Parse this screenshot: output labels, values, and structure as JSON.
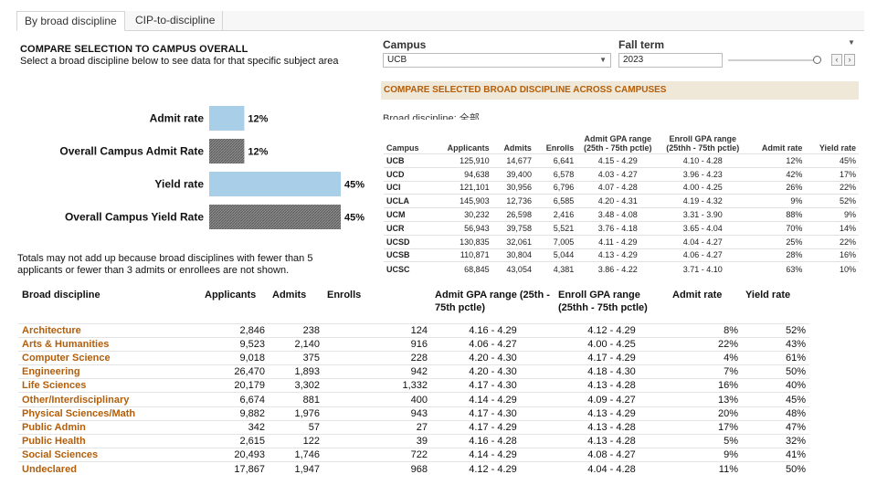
{
  "tabs": [
    {
      "label": "By broad discipline",
      "active": true
    },
    {
      "label": "CIP-to-discipline",
      "active": false
    }
  ],
  "left_panel": {
    "heading": "COMPARE SELECTION TO CAMPUS OVERALL",
    "subheading": "Select a broad discipline below to see data for that specific subject area",
    "note": "Totals may not add up because broad disciplines with fewer than 5 applicants or fewer than 3 admits or enrollees are not shown."
  },
  "chart_data": {
    "type": "bar",
    "orientation": "horizontal",
    "categories": [
      "Admit rate",
      "Overall Campus Admit Rate",
      "Yield rate",
      "Overall Campus Yield Rate"
    ],
    "values": [
      12,
      12,
      45,
      45
    ],
    "value_labels": [
      "12%",
      "12%",
      "45%",
      "45%"
    ],
    "unit": "%",
    "xlim": [
      0,
      45
    ],
    "bar_styles": [
      "solid-light-blue",
      "hatched-gray",
      "solid-light-blue",
      "hatched-gray"
    ],
    "colors": {
      "solid": "#a9cfe8",
      "hatched": "#7a7a7a"
    },
    "grid": false
  },
  "filters": {
    "campus_label": "Campus",
    "campus_value": "UCB",
    "fall_term_label": "Fall term",
    "fall_term_value": "2023",
    "prev_icon": "chevron-left-icon",
    "next_icon": "chevron-right-icon"
  },
  "campus_section": {
    "banner": "COMPARE SELECTED BROAD DISCIPLINE ACROSS CAMPUSES",
    "broad_discipline_label": "Broad discipline: 全部",
    "columns": [
      "Campus",
      "Applicants",
      "Admits",
      "Enrolls",
      "Admit GPA range (25th - 75th pctle)",
      "Enroll GPA range (25thh - 75th pctle)",
      "Admit rate",
      "Yield rate"
    ],
    "rows": [
      {
        "campus": "UCB",
        "applicants": "125,910",
        "admits": "14,677",
        "enrolls": "6,641",
        "admit_gpa": "4.15 - 4.29",
        "enroll_gpa": "4.10 - 4.28",
        "admit_rate": "12%",
        "yield_rate": "45%"
      },
      {
        "campus": "UCD",
        "applicants": "94,638",
        "admits": "39,400",
        "enrolls": "6,578",
        "admit_gpa": "4.03 - 4.27",
        "enroll_gpa": "3.96 - 4.23",
        "admit_rate": "42%",
        "yield_rate": "17%"
      },
      {
        "campus": "UCI",
        "applicants": "121,101",
        "admits": "30,956",
        "enrolls": "6,796",
        "admit_gpa": "4.07 - 4.28",
        "enroll_gpa": "4.00 - 4.25",
        "admit_rate": "26%",
        "yield_rate": "22%"
      },
      {
        "campus": "UCLA",
        "applicants": "145,903",
        "admits": "12,736",
        "enrolls": "6,585",
        "admit_gpa": "4.20 - 4.31",
        "enroll_gpa": "4.19 - 4.32",
        "admit_rate": "9%",
        "yield_rate": "52%"
      },
      {
        "campus": "UCM",
        "applicants": "30,232",
        "admits": "26,598",
        "enrolls": "2,416",
        "admit_gpa": "3.48 - 4.08",
        "enroll_gpa": "3.31 - 3.90",
        "admit_rate": "88%",
        "yield_rate": "9%"
      },
      {
        "campus": "UCR",
        "applicants": "56,943",
        "admits": "39,758",
        "enrolls": "5,521",
        "admit_gpa": "3.76 - 4.18",
        "enroll_gpa": "3.65 - 4.04",
        "admit_rate": "70%",
        "yield_rate": "14%"
      },
      {
        "campus": "UCSD",
        "applicants": "130,835",
        "admits": "32,061",
        "enrolls": "7,005",
        "admit_gpa": "4.11 - 4.29",
        "enroll_gpa": "4.04 - 4.27",
        "admit_rate": "25%",
        "yield_rate": "22%"
      },
      {
        "campus": "UCSB",
        "applicants": "110,871",
        "admits": "30,804",
        "enrolls": "5,044",
        "admit_gpa": "4.13 - 4.29",
        "enroll_gpa": "4.06 - 4.27",
        "admit_rate": "28%",
        "yield_rate": "16%"
      },
      {
        "campus": "UCSC",
        "applicants": "68,845",
        "admits": "43,054",
        "enrolls": "4,381",
        "admit_gpa": "3.86 - 4.22",
        "enroll_gpa": "3.71 - 4.10",
        "admit_rate": "63%",
        "yield_rate": "10%"
      }
    ]
  },
  "discipline_table": {
    "columns": [
      "Broad discipline",
      "Applicants",
      "Admits",
      "Enrolls",
      "Admit GPA range (25th - 75th pctle)",
      "Enroll GPA range (25thh - 75th pctle)",
      "Admit rate",
      "Yield rate"
    ],
    "rows": [
      {
        "name": "Architecture",
        "applicants": "2,846",
        "admits": "238",
        "enrolls": "124",
        "admit_gpa": "4.16 - 4.29",
        "enroll_gpa": "4.12 - 4.29",
        "admit_rate": "8%",
        "yield_rate": "52%"
      },
      {
        "name": "Arts & Humanities",
        "applicants": "9,523",
        "admits": "2,140",
        "enrolls": "916",
        "admit_gpa": "4.06 - 4.27",
        "enroll_gpa": "4.00 - 4.25",
        "admit_rate": "22%",
        "yield_rate": "43%"
      },
      {
        "name": "Computer Science",
        "applicants": "9,018",
        "admits": "375",
        "enrolls": "228",
        "admit_gpa": "4.20 - 4.30",
        "enroll_gpa": "4.17 - 4.29",
        "admit_rate": "4%",
        "yield_rate": "61%"
      },
      {
        "name": "Engineering",
        "applicants": "26,470",
        "admits": "1,893",
        "enrolls": "942",
        "admit_gpa": "4.20 - 4.30",
        "enroll_gpa": "4.18 - 4.30",
        "admit_rate": "7%",
        "yield_rate": "50%"
      },
      {
        "name": "Life Sciences",
        "applicants": "20,179",
        "admits": "3,302",
        "enrolls": "1,332",
        "admit_gpa": "4.17 - 4.30",
        "enroll_gpa": "4.13 - 4.28",
        "admit_rate": "16%",
        "yield_rate": "40%"
      },
      {
        "name": "Other/Interdisciplinary",
        "applicants": "6,674",
        "admits": "881",
        "enrolls": "400",
        "admit_gpa": "4.14 - 4.29",
        "enroll_gpa": "4.09 - 4.27",
        "admit_rate": "13%",
        "yield_rate": "45%"
      },
      {
        "name": "Physical Sciences/Math",
        "applicants": "9,882",
        "admits": "1,976",
        "enrolls": "943",
        "admit_gpa": "4.17 - 4.30",
        "enroll_gpa": "4.13 - 4.29",
        "admit_rate": "20%",
        "yield_rate": "48%"
      },
      {
        "name": "Public Admin",
        "applicants": "342",
        "admits": "57",
        "enrolls": "27",
        "admit_gpa": "4.17 - 4.29",
        "enroll_gpa": "4.13 - 4.28",
        "admit_rate": "17%",
        "yield_rate": "47%"
      },
      {
        "name": "Public Health",
        "applicants": "2,615",
        "admits": "122",
        "enrolls": "39",
        "admit_gpa": "4.16 - 4.28",
        "enroll_gpa": "4.13 - 4.28",
        "admit_rate": "5%",
        "yield_rate": "32%"
      },
      {
        "name": "Social Sciences",
        "applicants": "20,493",
        "admits": "1,746",
        "enrolls": "722",
        "admit_gpa": "4.14 - 4.29",
        "enroll_gpa": "4.08 - 4.27",
        "admit_rate": "9%",
        "yield_rate": "41%"
      },
      {
        "name": "Undeclared",
        "applicants": "17,867",
        "admits": "1,947",
        "enrolls": "968",
        "admit_gpa": "4.12 - 4.29",
        "enroll_gpa": "4.04 - 4.28",
        "admit_rate": "11%",
        "yield_rate": "50%"
      }
    ]
  }
}
